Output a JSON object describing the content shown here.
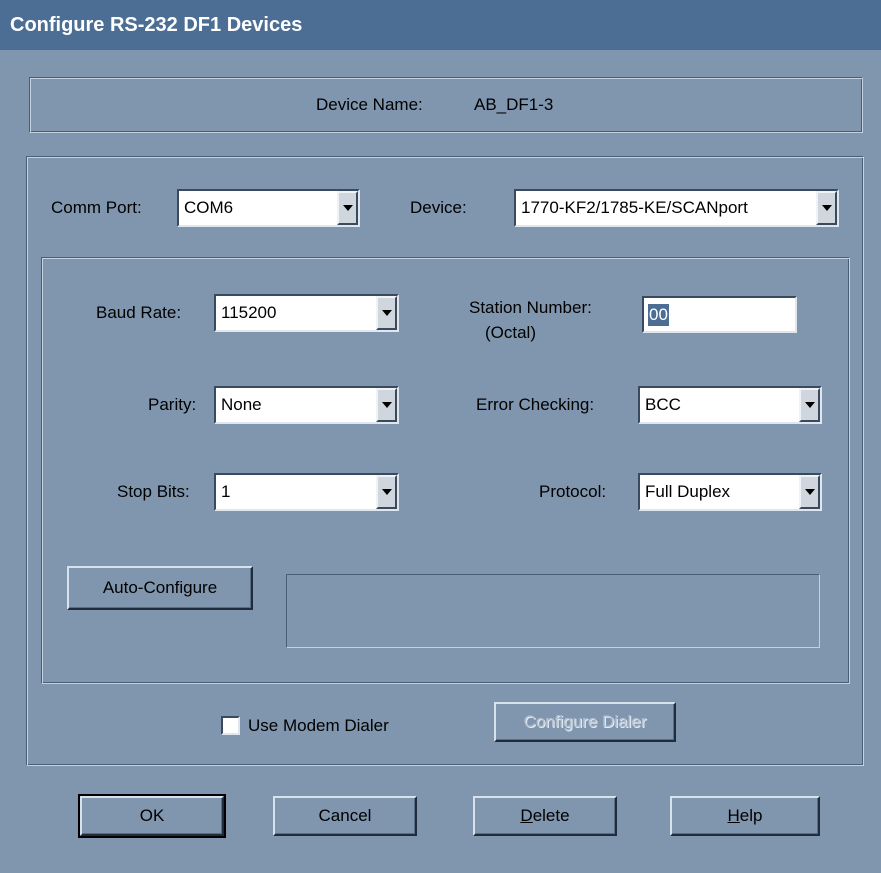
{
  "window": {
    "title": "Configure RS-232 DF1 Devices"
  },
  "device_name": {
    "label": "Device Name:",
    "value": "AB_DF1-3"
  },
  "comm_port": {
    "label": "Comm Port:",
    "value": "COM6"
  },
  "device": {
    "label": "Device:",
    "value": "1770-KF2/1785-KE/SCANport"
  },
  "baud_rate": {
    "label": "Baud Rate:",
    "value": "115200"
  },
  "station_number": {
    "label_line1": "Station Number:",
    "label_line2": "(Octal)",
    "value": "00"
  },
  "parity": {
    "label": "Parity:",
    "value": "None"
  },
  "error_checking": {
    "label": "Error Checking:",
    "value": "BCC"
  },
  "stop_bits": {
    "label": "Stop Bits:",
    "value": "1"
  },
  "protocol": {
    "label": "Protocol:",
    "value": "Full Duplex"
  },
  "auto_configure": {
    "label": "Auto-Configure",
    "status": ""
  },
  "modem": {
    "checkbox_label": "Use Modem Dialer",
    "checked": false,
    "configure_label": "Configure Dialer"
  },
  "buttons": {
    "ok": "OK",
    "cancel": "Cancel",
    "delete_prefix": "D",
    "delete_rest": "elete",
    "help_prefix": "H",
    "help_rest": "elp"
  },
  "colors": {
    "window_bg": "#8096ae",
    "titlebar": "#4c6e94",
    "selection": "#4c6e94"
  }
}
